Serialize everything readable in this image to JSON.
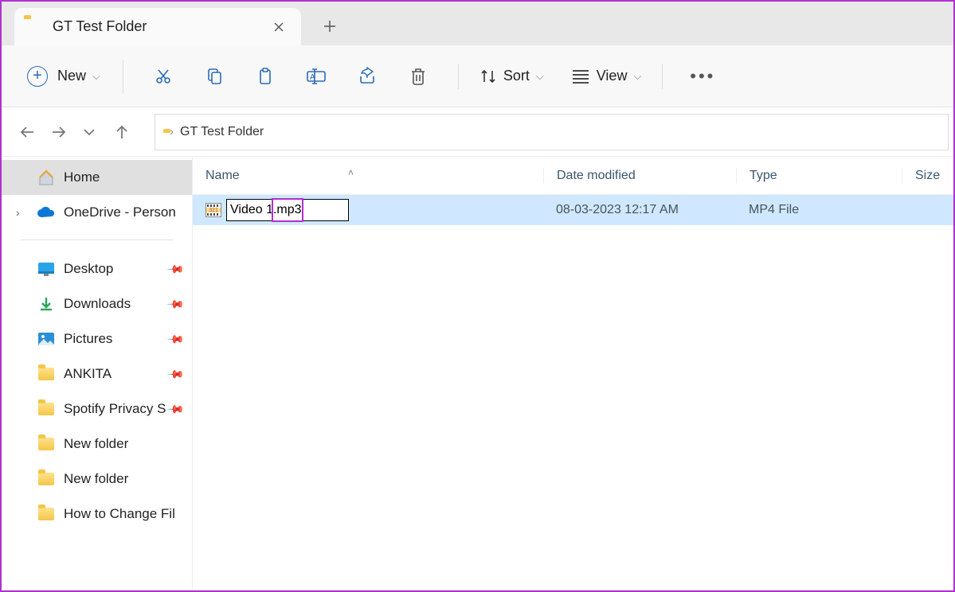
{
  "tab": {
    "title": "GT Test Folder"
  },
  "toolbar": {
    "new_label": "New",
    "sort_label": "Sort",
    "view_label": "View"
  },
  "breadcrumb": {
    "current": "GT Test Folder"
  },
  "sidebar": {
    "home": "Home",
    "onedrive": "OneDrive - Person",
    "quick": [
      {
        "label": "Desktop",
        "pinned": true,
        "icon": "desktop"
      },
      {
        "label": "Downloads",
        "pinned": true,
        "icon": "downloads"
      },
      {
        "label": "Pictures",
        "pinned": true,
        "icon": "pictures"
      },
      {
        "label": "ANKITA",
        "pinned": true,
        "icon": "folder"
      },
      {
        "label": "Spotify Privacy S",
        "pinned": true,
        "icon": "folder"
      },
      {
        "label": "New folder",
        "pinned": false,
        "icon": "folder"
      },
      {
        "label": "New folder",
        "pinned": false,
        "icon": "folder"
      },
      {
        "label": "How to Change Fil",
        "pinned": false,
        "icon": "folder"
      }
    ]
  },
  "columns": {
    "name": "Name",
    "date": "Date modified",
    "type": "Type",
    "size": "Size"
  },
  "file": {
    "rename_value": "Video 1.mp3",
    "date": "08-03-2023 12:17 AM",
    "type": "MP4 File",
    "size": ""
  }
}
